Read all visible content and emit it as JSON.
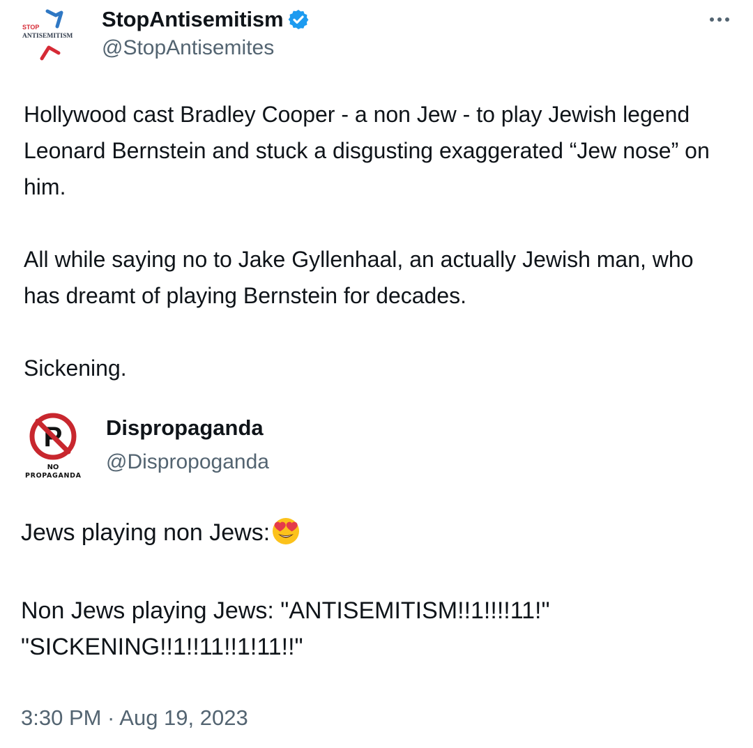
{
  "tweet": {
    "avatar_text": {
      "line1": "STOP",
      "line2": "ANTISEMITISM"
    },
    "display_name": "StopAntisemitism",
    "handle": "@StopAntisemites",
    "paragraphs": [
      "Hollywood cast Bradley Cooper - a non Jew - to play Jewish legend Leonard Bernstein and stuck a disgusting exaggerated “Jew nose” on him.",
      "All while saying no to Jake Gyllenhaal, an actually Jewish man, who has dreamt of playing Bernstein for decades.",
      "Sickening."
    ]
  },
  "reply": {
    "avatar_text": {
      "line1": "NO",
      "line2": "PROPAGANDA",
      "letter": "P"
    },
    "display_name": "Dispropaganda",
    "handle": "@Dispropoganda",
    "line1": "Jews playing non Jews:",
    "line1_emoji": "heart-eyes-emoji",
    "line2": "Non Jews playing Jews: \"ANTISEMITISM!!1!!!!11!\" \"SICKENING!!1!!11!!1!11!!\"",
    "timestamp": "3:30 PM · Aug 19, 2023"
  },
  "icons": {
    "verified": "verified-badge-icon",
    "more": "more-options-icon"
  },
  "colors": {
    "text": "#0f1419",
    "secondary": "#536471",
    "verified": "#1d9bf0",
    "logo_red": "#d62a35",
    "logo_blue": "#2f78c4",
    "no_sign_red": "#c8272e"
  }
}
